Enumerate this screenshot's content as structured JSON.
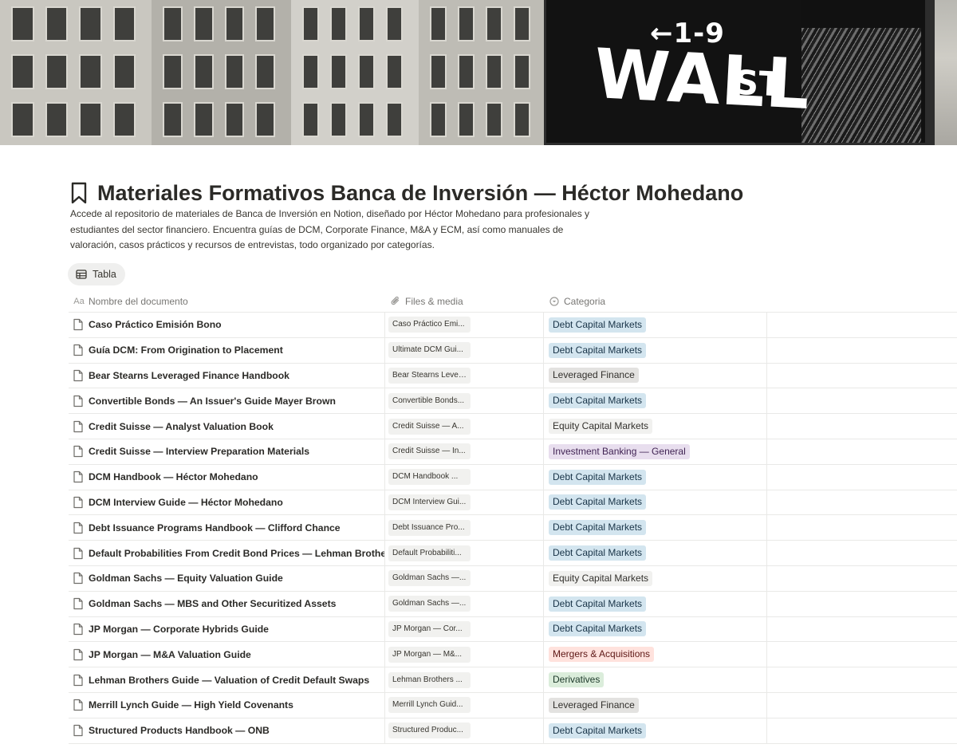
{
  "cover": {
    "sign_arrow": "←1-9",
    "sign_street": "WALL",
    "sign_suffix": "ST"
  },
  "page": {
    "title": "Materiales Formativos Banca de Inversión — Héctor Mohedano",
    "title_icon": "bookmark-icon",
    "description": "Accede al repositorio de materiales de Banca de Inversión en Notion, diseñado por Héctor Mohedano para profesionales y estudiantes del sector financiero. Encuentra guías de DCM, Corporate Finance, M&A y ECM, así como manuales de valoración, casos prácticos y recursos de entrevistas, todo organizado por categorías."
  },
  "view": {
    "label": "Tabla",
    "icon": "table-icon"
  },
  "table": {
    "headers": {
      "name": "Nombre del documento",
      "files": "Files & media",
      "category": "Categoria"
    },
    "header_icons": {
      "name": "Aa",
      "files": "paperclip-icon",
      "category": "select-icon"
    },
    "tag_colors": {
      "blue": "#d3e5ef",
      "gray": "#e3e2e0",
      "purple": "#e8deee",
      "red": "#ffe2dd",
      "green": "#dbeddb"
    },
    "rows": [
      {
        "name": "Caso Práctico Emisión Bono",
        "file": "Caso Práctico Emi...",
        "category": "Debt Capital Markets",
        "color": "blue"
      },
      {
        "name": "Guía DCM: From Origination to Placement",
        "file": "Ultimate DCM Gui...",
        "category": "Debt Capital Markets",
        "color": "blue"
      },
      {
        "name": "Bear Stearns Leveraged Finance Handbook",
        "file": "Bear Stearns Lever...",
        "category": "Leveraged Finance",
        "color": "gray"
      },
      {
        "name": "Convertible Bonds — An Issuer's Guide Mayer Brown",
        "file": "Convertible Bonds...",
        "category": "Debt Capital Markets",
        "color": "blue"
      },
      {
        "name": "Credit Suisse — Analyst Valuation Book",
        "file": "Credit Suisse — A...",
        "category": "Equity Capital Markets",
        "color": "none"
      },
      {
        "name": "Credit Suisse — Interview Preparation Materials",
        "file": "Credit Suisse — In...",
        "category": "Investment Banking — General",
        "color": "purple"
      },
      {
        "name": "DCM Handbook — Héctor Mohedano",
        "file": "DCM Handbook ...",
        "category": "Debt Capital Markets",
        "color": "blue"
      },
      {
        "name": "DCM Interview Guide — Héctor Mohedano",
        "file": "DCM Interview Gui...",
        "category": "Debt Capital Markets",
        "color": "blue"
      },
      {
        "name": "Debt Issuance Programs Handbook — Clifford Chance",
        "file": "Debt Issuance Pro...",
        "category": "Debt Capital Markets",
        "color": "blue"
      },
      {
        "name": "Default Probabilities From Credit Bond Prices — Lehman Brothers",
        "file": "Default Probabiliti...",
        "category": "Debt Capital Markets",
        "color": "blue"
      },
      {
        "name": "Goldman Sachs — Equity Valuation Guide",
        "file": "Goldman Sachs —...",
        "category": "Equity Capital Markets",
        "color": "none"
      },
      {
        "name": "Goldman Sachs — MBS and Other Securitized Assets",
        "file": "Goldman Sachs —...",
        "category": "Debt Capital Markets",
        "color": "blue"
      },
      {
        "name": "JP Morgan — Corporate Hybrids Guide",
        "file": "JP Morgan — Cor...",
        "category": "Debt Capital Markets",
        "color": "blue"
      },
      {
        "name": "JP Morgan — M&A Valuation Guide",
        "file": "JP Morgan — M&...",
        "category": "Mergers & Acquisitions",
        "color": "red"
      },
      {
        "name": "Lehman Brothers Guide — Valuation of Credit Default Swaps",
        "file": "Lehman Brothers ...",
        "category": "Derivatives",
        "color": "green"
      },
      {
        "name": "Merrill Lynch Guide — High Yield Covenants",
        "file": "Merrill Lynch Guid...",
        "category": "Leveraged Finance",
        "color": "gray"
      },
      {
        "name": "Structured Products Handbook — ONB",
        "file": "Structured Produc...",
        "category": "Debt Capital Markets",
        "color": "blue"
      }
    ]
  }
}
